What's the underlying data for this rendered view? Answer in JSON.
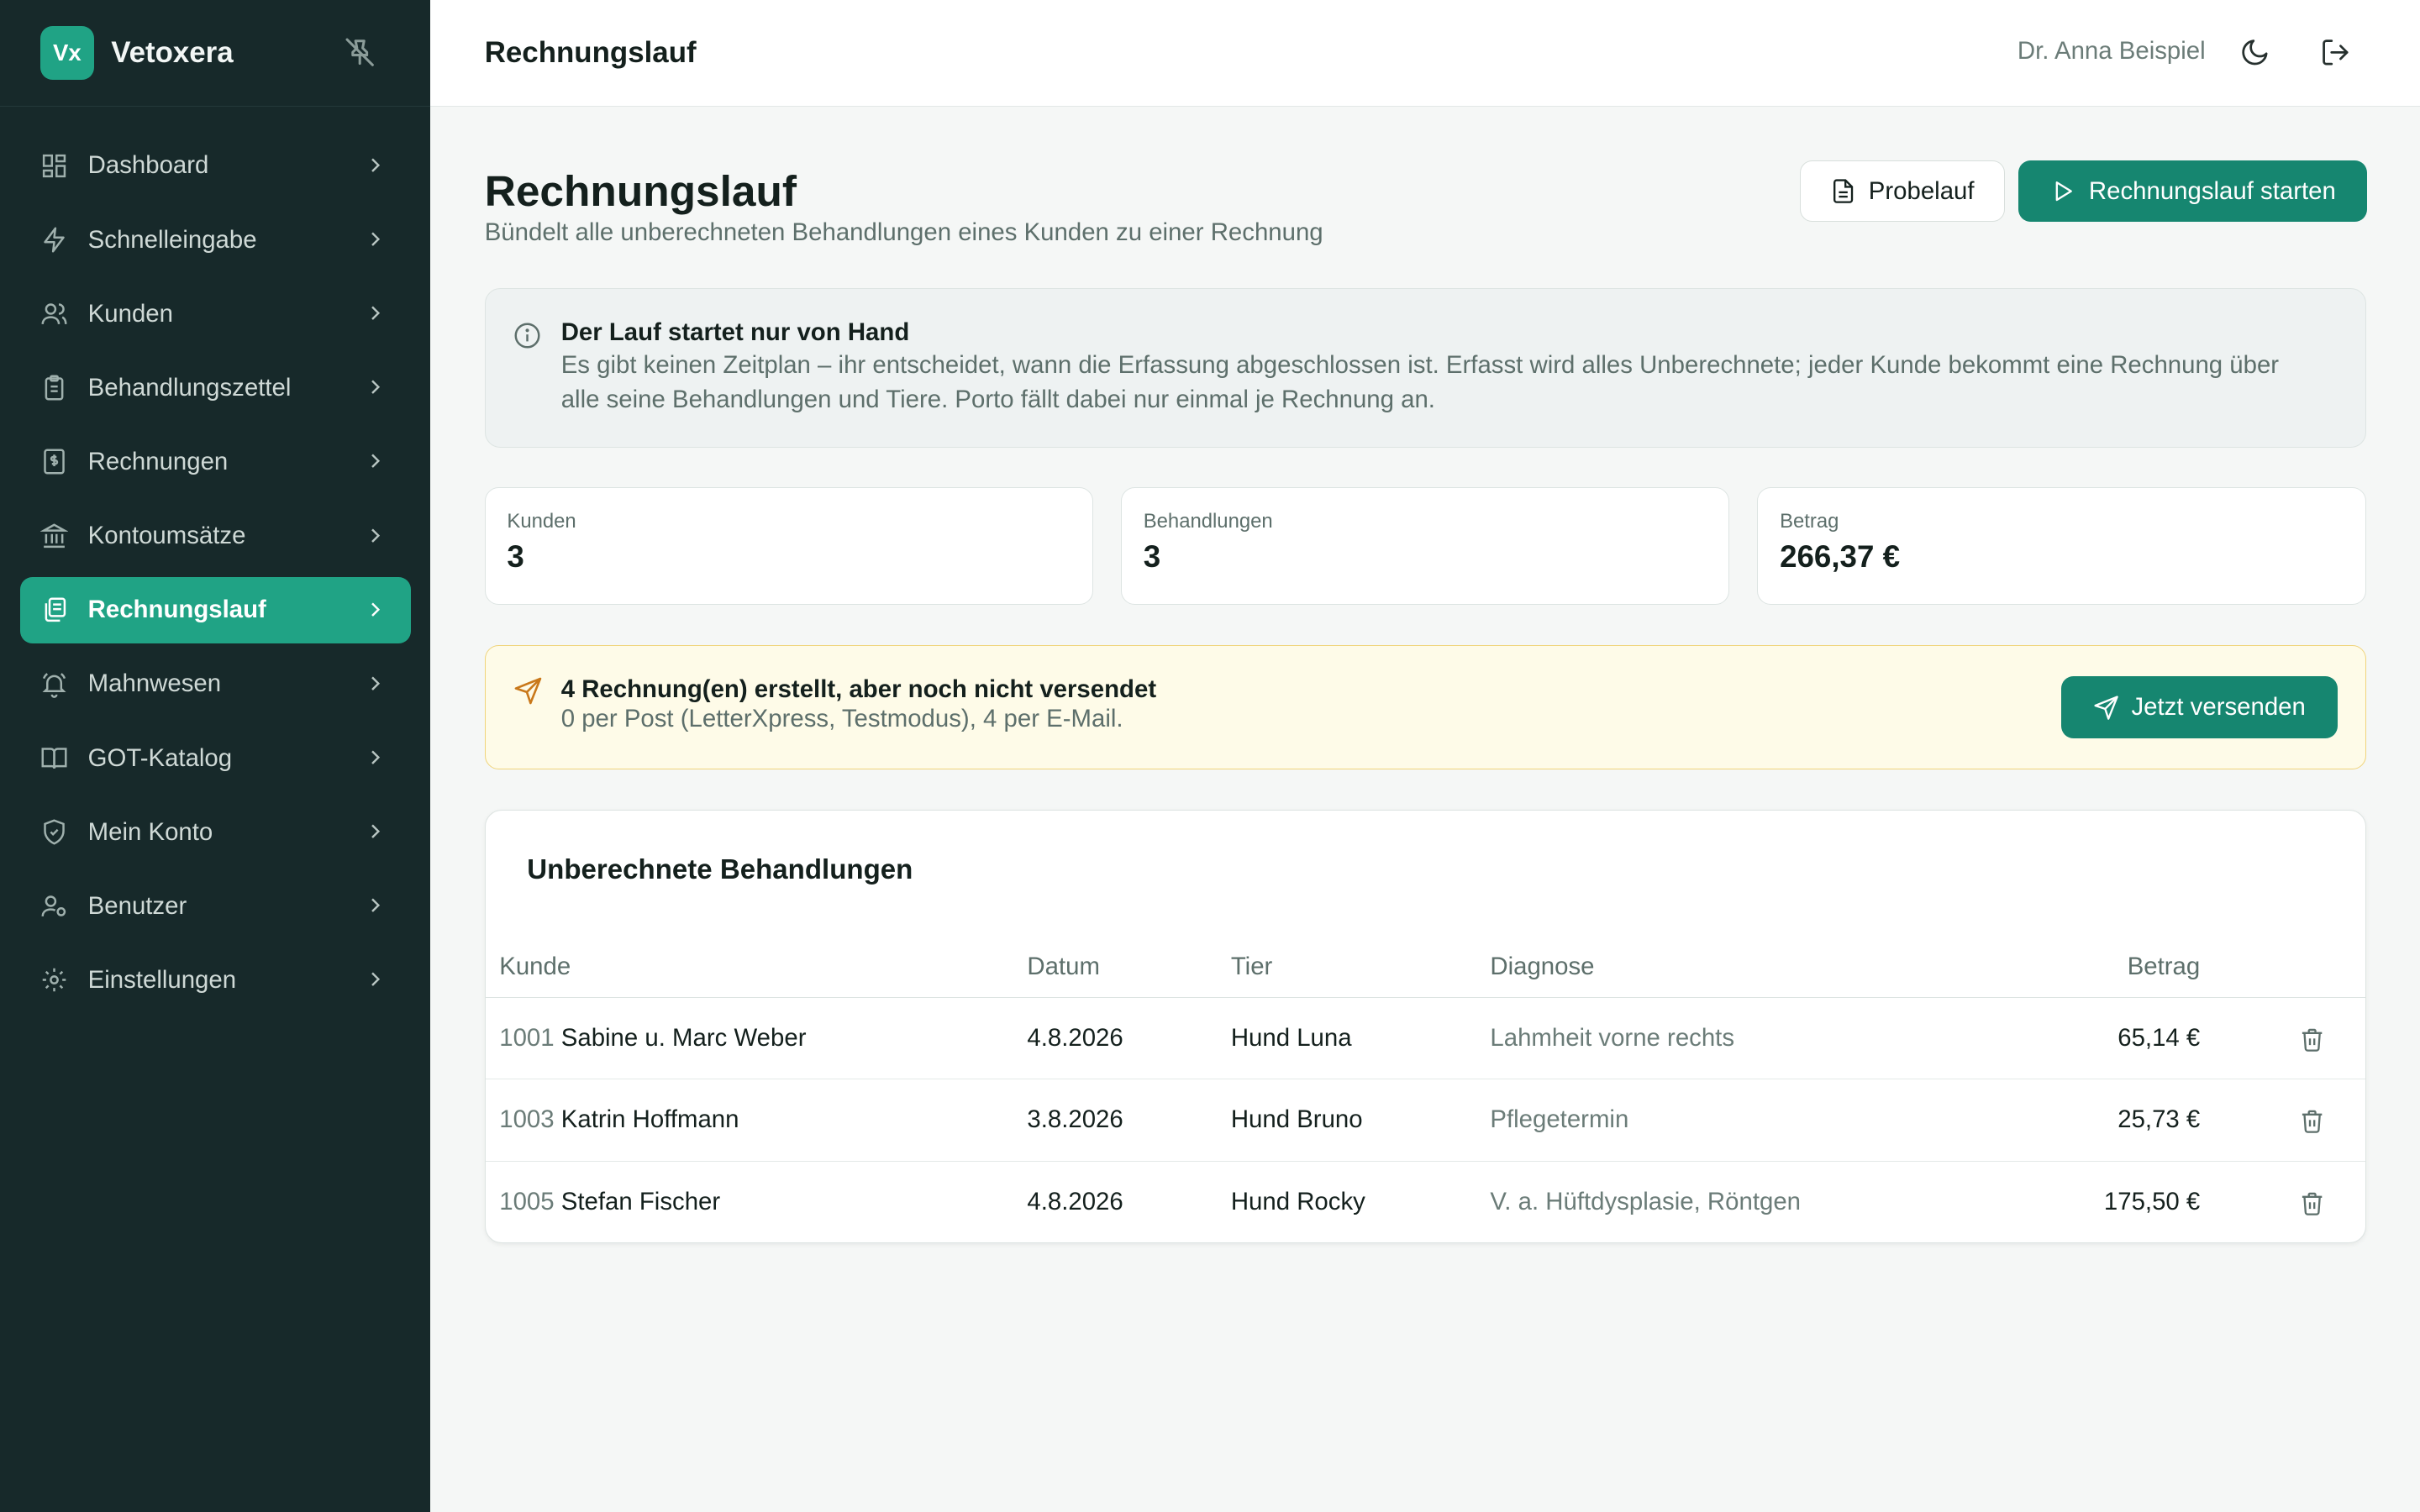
{
  "brand": {
    "logo_text": "Vx",
    "name": "Vetoxera"
  },
  "nav": {
    "items": [
      {
        "label": "Dashboard",
        "icon": "dashboard-icon"
      },
      {
        "label": "Schnelleingabe",
        "icon": "lightning-icon"
      },
      {
        "label": "Kunden",
        "icon": "users-icon"
      },
      {
        "label": "Behandlungszettel",
        "icon": "clipboard-icon"
      },
      {
        "label": "Rechnungen",
        "icon": "invoice-icon"
      },
      {
        "label": "Kontoumsätze",
        "icon": "bank-icon"
      },
      {
        "label": "Rechnungslauf",
        "icon": "documents-icon",
        "active": true
      },
      {
        "label": "Mahnwesen",
        "icon": "bell-icon"
      },
      {
        "label": "GOT-Katalog",
        "icon": "book-icon"
      },
      {
        "label": "Mein Konto",
        "icon": "shield-icon"
      },
      {
        "label": "Benutzer",
        "icon": "user-gear-icon"
      },
      {
        "label": "Einstellungen",
        "icon": "gear-icon"
      }
    ]
  },
  "topbar": {
    "title": "Rechnungslauf",
    "user": "Dr. Anna Beispiel"
  },
  "page": {
    "title": "Rechnungslauf",
    "subtitle": "Bündelt alle unberechneten Behandlungen eines Kunden zu einer Rechnung",
    "btn_probelauf": "Probelauf",
    "btn_start": "Rechnungslauf starten"
  },
  "info": {
    "title": "Der Lauf startet nur von Hand",
    "text": "Es gibt keinen Zeitplan – ihr entscheidet, wann die Erfassung abgeschlossen ist. Erfasst wird alles Unberechnete; jeder Kunde bekommt eine Rechnung über alle seine Behandlungen und Tiere. Porto fällt dabei nur einmal je Rechnung an."
  },
  "stats": [
    {
      "label": "Kunden",
      "value": "3"
    },
    {
      "label": "Behandlungen",
      "value": "3"
    },
    {
      "label": "Betrag",
      "value": "266,37 €"
    }
  ],
  "alert": {
    "title": "4 Rechnung(en) erstellt, aber noch nicht versendet",
    "text": "0 per Post (LetterXpress, Testmodus), 4 per E-Mail.",
    "button": "Jetzt versenden"
  },
  "table": {
    "title": "Unberechnete Behandlungen",
    "headers": {
      "kunde": "Kunde",
      "datum": "Datum",
      "tier": "Tier",
      "diagnose": "Diagnose",
      "betrag": "Betrag"
    },
    "rows": [
      {
        "knr": "1001",
        "name": "Sabine u. Marc Weber",
        "datum": "4.8.2026",
        "tier": "Hund Luna",
        "diagnose": "Lahmheit vorne rechts",
        "betrag": "65,14 €"
      },
      {
        "knr": "1003",
        "name": "Katrin Hoffmann",
        "datum": "3.8.2026",
        "tier": "Hund Bruno",
        "diagnose": "Pflegetermin",
        "betrag": "25,73 €"
      },
      {
        "knr": "1005",
        "name": "Stefan Fischer",
        "datum": "4.8.2026",
        "tier": "Hund Rocky",
        "diagnose": "V. a. Hüftdysplasie, Röntgen",
        "betrag": "175,50 €"
      }
    ]
  },
  "colors": {
    "sidebar_bg": "#17292a",
    "accent": "#20a385",
    "primary_button": "#168670",
    "alert_bg": "#fefbe8",
    "alert_border": "#f0d47a"
  }
}
